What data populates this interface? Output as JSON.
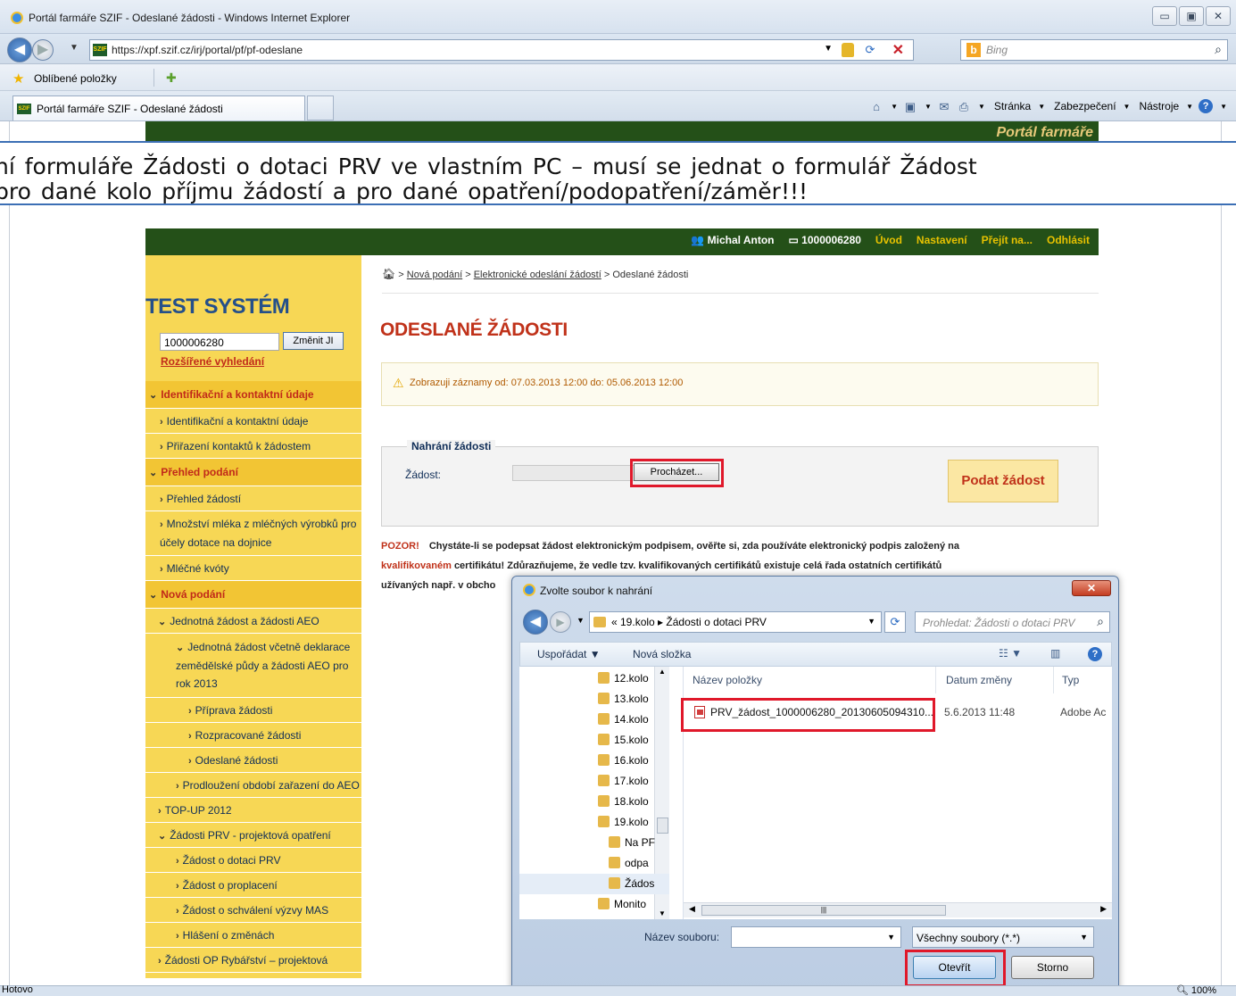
{
  "window": {
    "title": "Portál farmáře SZIF - Odeslané žádosti - Windows Internet Explorer",
    "min": "▭",
    "max": "▣",
    "close": "✕"
  },
  "address": {
    "url": "https://xpf.szif.cz/irj/portal/pf/pf-odeslane",
    "favicon": "SZIF"
  },
  "search": {
    "placeholder": "Bing"
  },
  "favorites": {
    "label": "Oblíbené položky"
  },
  "tab": {
    "label": "Portál farmáře SZIF - Odeslané žádosti"
  },
  "commands": {
    "page": "Stránka",
    "security": "Zabezpečení",
    "tools": "Nástroje"
  },
  "header_band": {
    "text": "Portál farmáře"
  },
  "banner": {
    "line1": "ní formuláře Žádosti o dotaci PRV ve vlastním PC – musí se jednat o formulář Žádost",
    "line2": "pro dané kolo příjmu žádostí a pro dané opatření/podopatření/záměr!!!"
  },
  "topnav": {
    "user": "Michal Anton",
    "id": "1000006280",
    "links": [
      "Úvod",
      "Nastavení",
      "Přejít na...",
      "Odhlásit"
    ]
  },
  "sidebar": {
    "title": "TEST SYSTÉM",
    "id_value": "1000006280",
    "change_button": "Změnit JI",
    "advanced_search": "Rozšířené vyhledání",
    "items": [
      {
        "type": "hdr",
        "label": "Identifikační a kontaktní údaje"
      },
      {
        "type": "lvl1",
        "label": "Identifikační a kontaktní údaje"
      },
      {
        "type": "lvl1",
        "label": "Přiřazení kontaktů k žádostem"
      },
      {
        "type": "hdr",
        "label": "Přehled podání"
      },
      {
        "type": "lvl1",
        "label": "Přehled žádostí"
      },
      {
        "type": "lvl1",
        "label": "Množství mléka z mléčných výrobků pro účely dotace na dojnice"
      },
      {
        "type": "lvl1",
        "label": "Mléčné kvóty"
      },
      {
        "type": "hdr",
        "label": "Nová podání"
      },
      {
        "type": "lvl2",
        "label": "Jednotná žádost a žádosti AEO"
      },
      {
        "type": "lvl3",
        "label": "Jednotná žádost včetně deklarace zemědělské půdy a žádosti AEO pro rok 2013"
      },
      {
        "type": "lvl4",
        "label": "Příprava žádosti"
      },
      {
        "type": "lvl4",
        "label": "Rozpracované žádosti"
      },
      {
        "type": "lvl4",
        "label": "Odeslané žádosti"
      },
      {
        "type": "lvl3",
        "label": "Prodloužení období zařazení do AEO"
      },
      {
        "type": "lvl2",
        "label": "TOP-UP 2012"
      },
      {
        "type": "lvl2",
        "label": "Žádosti PRV - projektová opatření"
      },
      {
        "type": "lvl3",
        "label": "Žádost o dotaci PRV"
      },
      {
        "type": "lvl3",
        "label": "Žádost o proplacení"
      },
      {
        "type": "lvl3",
        "label": "Žádost o schválení výzvy MAS"
      },
      {
        "type": "lvl3",
        "label": "Hlášení o změnách"
      },
      {
        "type": "lvl2",
        "label": "Žádosti OP Rybářství – projektová"
      }
    ]
  },
  "breadcrumb": {
    "items": [
      "Nová podání",
      "Elektronické odeslání žádostí"
    ],
    "current": "Odeslané žádosti"
  },
  "page_title": "ODESLANÉ ŽÁDOSTI",
  "info": {
    "text": "Zobrazuji záznamy od: 07.03.2013 12:00 do: 05.06.2013 12:00"
  },
  "upload": {
    "legend": "Nahrání žádosti",
    "label": "Žádost:",
    "browse": "Procházet...",
    "submit": "Podat žádost"
  },
  "warning": {
    "prefix": "POZOR!",
    "part1": "Chystáte-li se podepsat žádost elektronickým podpisem, ověřte si, zda používáte elektronický podpis založený na",
    "kv": "kvalifikovaném",
    "part2": "certifikátu! Zdůrazňujeme, že vedle tzv. kvalifikovaných certifikátů existuje celá řada ostatních certifikátů",
    "part3": "užívaných např. v obcho"
  },
  "dialog": {
    "title": "Zvolte soubor k nahrání",
    "path": "« 19.kolo ▸ Žádosti o dotaci PRV",
    "search_placeholder": "Prohledat: Žádosti o dotaci PRV",
    "organize": "Uspořádat",
    "new_folder": "Nová složka",
    "tree": [
      "12.kolo",
      "13.kolo",
      "14.kolo",
      "15.kolo",
      "16.kolo",
      "17.kolo",
      "18.kolo",
      "19.kolo",
      "Na PF",
      "odpa",
      "Žádos",
      "Monito"
    ],
    "columns": [
      "Název položky",
      "Datum změny",
      "Typ"
    ],
    "file": {
      "name": "PRV_žádost_1000006280_20130605094310...",
      "date": "5.6.2013 11:48",
      "type": "Adobe Ac"
    },
    "filename_label": "Název souboru:",
    "filetype": "Všechny soubory (*.*)",
    "open": "Otevřít",
    "cancel": "Storno"
  },
  "status": {
    "text": "Hotovo",
    "zoom": "100%"
  }
}
